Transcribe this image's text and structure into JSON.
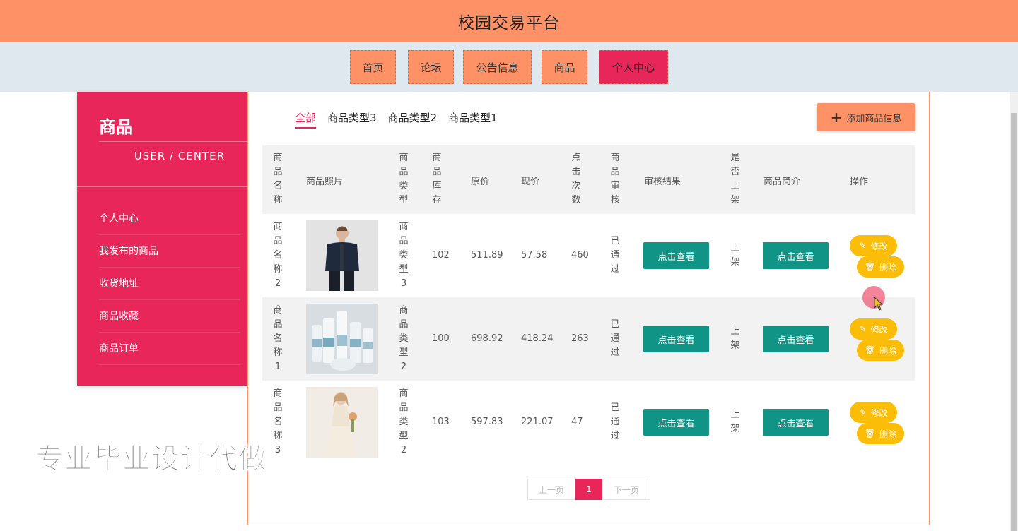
{
  "header": {
    "title": "校园交易平台"
  },
  "nav": [
    {
      "label": "首页"
    },
    {
      "label": "论坛"
    },
    {
      "label": "公告信息"
    },
    {
      "label": "商品"
    },
    {
      "label": "个人中心",
      "active": true
    }
  ],
  "sidebar": {
    "title": "商品",
    "subtitle": "USER / CENTER",
    "items": [
      {
        "label": "个人中心"
      },
      {
        "label": "我发布的商品"
      },
      {
        "label": "收货地址"
      },
      {
        "label": "商品收藏"
      },
      {
        "label": "商品订单"
      }
    ]
  },
  "tabs": [
    {
      "label": "全部",
      "active": true
    },
    {
      "label": "商品类型3"
    },
    {
      "label": "商品类型2"
    },
    {
      "label": "商品类型1"
    }
  ],
  "add_button": {
    "label": "添加商品信息"
  },
  "table": {
    "headers": {
      "name": "商品名称",
      "photo": "商品照片",
      "type": "商品类型",
      "stock": "商品库存",
      "original_price": "原价",
      "current_price": "现价",
      "clicks": "点击次数",
      "audit": "商品审核",
      "audit_result": "审核结果",
      "listed": "是否上架",
      "intro": "商品简介",
      "actions": "操作"
    },
    "rows": [
      {
        "name": "商品名称2",
        "photo": "man-jacket",
        "type": "商品类型3",
        "stock": "102",
        "original_price": "511.89",
        "current_price": "57.58",
        "clicks": "460",
        "audit": "已通过",
        "audit_result_btn": "点击查看",
        "listed": "上架",
        "intro_btn": "点击查看",
        "edit": "修改",
        "delete": "删除"
      },
      {
        "name": "商品名称1",
        "photo": "cosmetics",
        "type": "商品类型2",
        "stock": "100",
        "original_price": "698.92",
        "current_price": "418.24",
        "clicks": "263",
        "audit": "已通过",
        "audit_result_btn": "点击查看",
        "listed": "上架",
        "intro_btn": "点击查看",
        "edit": "修改",
        "delete": "删除"
      },
      {
        "name": "商品名称3",
        "photo": "woman-dress",
        "type": "商品类型2",
        "stock": "103",
        "original_price": "597.83",
        "current_price": "221.07",
        "clicks": "47",
        "audit": "已通过",
        "audit_result_btn": "点击查看",
        "listed": "上架",
        "intro_btn": "点击查看",
        "edit": "修改",
        "delete": "删除"
      }
    ]
  },
  "pagination": {
    "prev": "上一页",
    "current": "1",
    "next": "下一页"
  },
  "watermark": "专业毕业设计代做",
  "colors": {
    "header": "#ff9166",
    "accent": "#e8265a",
    "nav_bg": "#dfe8ef",
    "teal": "#0f9486",
    "yellow": "#fbbd08"
  }
}
